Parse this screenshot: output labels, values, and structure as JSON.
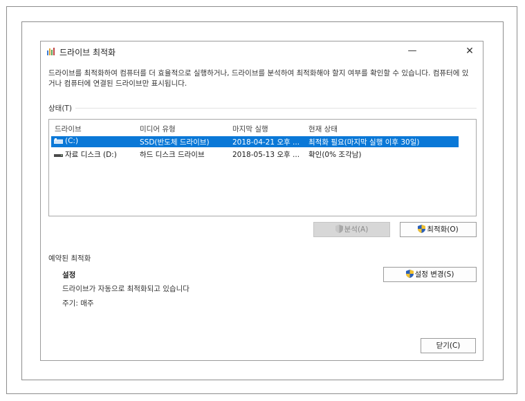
{
  "window": {
    "title": "드라이브 최적화",
    "minimize_glyph": "—",
    "close_glyph": "✕"
  },
  "description": "드라이브를 최적화하여 컴퓨터를 더 효율적으로 실행하거나, 드라이브를 분석하여 최적화해야 할지 여부를 확인할 수 있습니다. 컴퓨터에 있거나 컴퓨터에 연결된 드라이브만 표시됩니다.",
  "status": {
    "label": "상태(T)",
    "columns": [
      "드라이브",
      "미디어 유형",
      "마지막 실행",
      "현재 상태"
    ],
    "rows": [
      {
        "drive": "(C:)",
        "media": "SSD(반도체 드라이브)",
        "last_run": "2018-04-21 오후 ...",
        "state": "최적화 필요(마지막 실행 이후 30일)",
        "selected": true,
        "icon": "ssd-drive-icon"
      },
      {
        "drive": "자료 디스크 (D:)",
        "media": "하드 디스크 드라이브",
        "last_run": "2018-05-13 오후 ...",
        "state": "확인(0% 조각남)",
        "selected": false,
        "icon": "hdd-drive-icon"
      }
    ]
  },
  "buttons": {
    "analyze": "분석(A)",
    "optimize": "최적화(O)",
    "change_settings": "설정 변경(S)",
    "close": "닫기(C)"
  },
  "scheduled": {
    "label": "예약된 최적화",
    "title": "설정",
    "description": "드라이브가 자동으로 최적화되고 있습니다",
    "frequency": "주기: 매주"
  },
  "colors": {
    "selection": "#0a78d7",
    "shield_blue": "#2a5fb8",
    "shield_yellow": "#f2c12e"
  }
}
